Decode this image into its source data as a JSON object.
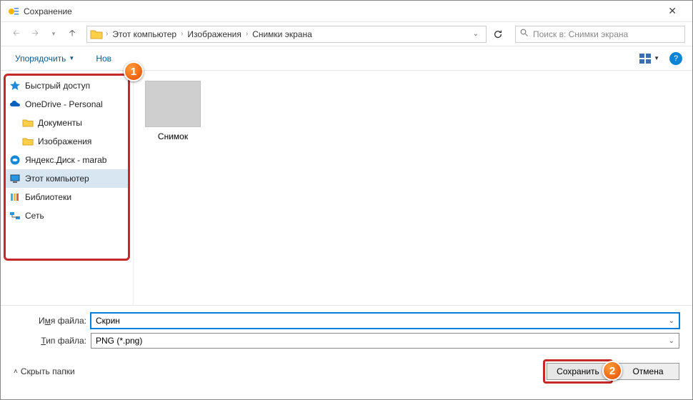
{
  "window": {
    "title": "Сохранение"
  },
  "nav": {
    "crumbs": [
      "Этот компьютер",
      "Изображения",
      "Снимки экрана"
    ],
    "search_placeholder": "Поиск в: Снимки экрана"
  },
  "toolbar": {
    "organize": "Упорядочить",
    "new_folder": "Нов"
  },
  "sidebar": {
    "items": [
      {
        "label": "Быстрый доступ",
        "icon": "star"
      },
      {
        "label": "OneDrive - Personal",
        "icon": "onedrive"
      },
      {
        "label": "Документы",
        "icon": "folder",
        "indent": 1
      },
      {
        "label": "Изображения",
        "icon": "folder",
        "indent": 1
      },
      {
        "label": "Яндекс.Диск - marab",
        "icon": "yadisk"
      },
      {
        "label": "Этот компьютер",
        "icon": "pc",
        "selected": true
      },
      {
        "label": "Библиотеки",
        "icon": "libraries"
      },
      {
        "label": "Сеть",
        "icon": "network"
      }
    ]
  },
  "files": [
    {
      "name": "Снимок"
    }
  ],
  "form": {
    "filename_label_pre": "И",
    "filename_label_ul": "м",
    "filename_label_post": "я файла:",
    "filetype_label_pre": "",
    "filetype_label_ul": "Т",
    "filetype_label_post": "ип файла:",
    "filename_value": "Скрин",
    "filetype_value": "PNG (*.png)"
  },
  "footer": {
    "hide_folders": "Скрыть папки",
    "save": "Сохранить",
    "cancel": "Отмена"
  },
  "markers": {
    "m1": "1",
    "m2": "2"
  }
}
